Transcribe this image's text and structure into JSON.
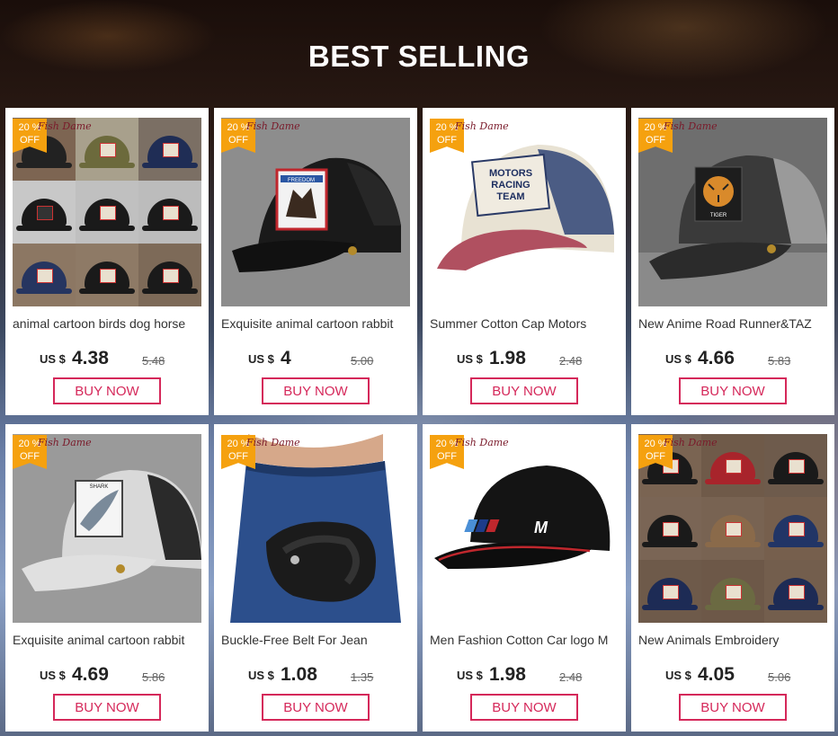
{
  "heading": "BEST SELLING",
  "brand_script": "Fish Dame",
  "discount": {
    "line1": "20 %",
    "line2": "OFF"
  },
  "currency": "US $",
  "buy_label": "BUY NOW",
  "products": [
    {
      "name": "animal cartoon birds dog horse",
      "price": "4.38",
      "old_price": "5.48",
      "image": "cap-collage-icon"
    },
    {
      "name": "Exquisite animal cartoon rabbit",
      "price": "4",
      "old_price": "5.00",
      "image": "eagle-patch-cap-icon"
    },
    {
      "name": "Summer Cotton Cap Motors",
      "price": "1.98",
      "old_price": "2.48",
      "image": "motors-racing-cap-icon"
    },
    {
      "name": "New Anime Road Runner&TAZ",
      "price": "4.66",
      "old_price": "5.83",
      "image": "tiger-patch-cap-icon"
    },
    {
      "name": "Exquisite animal cartoon rabbit",
      "price": "4.69",
      "old_price": "5.86",
      "image": "shark-patch-cap-icon"
    },
    {
      "name": "Buckle-Free Belt For Jean",
      "price": "1.08",
      "old_price": "1.35",
      "image": "belt-jeans-icon"
    },
    {
      "name": "Men Fashion Cotton Car logo M",
      "price": "1.98",
      "old_price": "2.48",
      "image": "m-logo-cap-icon"
    },
    {
      "name": "New Animals Embroidery",
      "price": "4.05",
      "old_price": "5.06",
      "image": "animal-caps-collage-icon"
    }
  ],
  "patch_texts": {
    "eagle": "FREEDOM",
    "motors": [
      "MOTORS",
      "RACING",
      "TEAM"
    ],
    "tiger": "TIGER",
    "shark": "SHARK",
    "mlogo": "M"
  }
}
